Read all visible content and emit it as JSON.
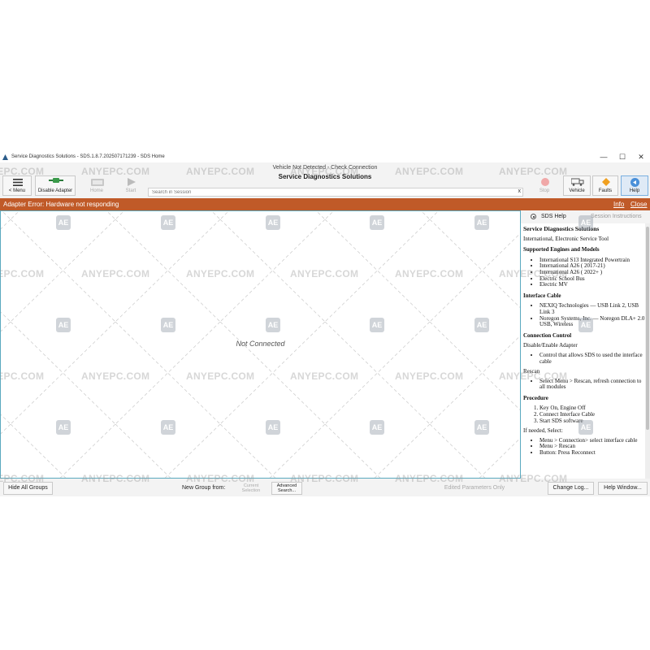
{
  "window": {
    "title": "Service Diagnostics Solutions - SDS.1.8.7.202507171239 - SDS Home",
    "minimize": "—",
    "maximize": "☐",
    "close": "✕"
  },
  "toolbar": {
    "menu_label": "< Menu",
    "disable_adapter_label": "Disable Adapter",
    "home_label": "Home",
    "start_label": "Start",
    "stop_label": "Stop",
    "vehicle_label": "Vehicle",
    "faults_label": "Faults",
    "help_label": "Help",
    "status_line1": "Vehicle Not Detected - Check Connection",
    "status_line2": "Service Diagnostics Solutions",
    "search_placeholder": "Search in Session",
    "search_clear": "x"
  },
  "error_bar": {
    "message": "Adapter Error: Hardware not responding",
    "info_link": "Info",
    "close_link": "Close"
  },
  "canvas": {
    "status_text": "Not Connected"
  },
  "help_pane": {
    "tab_help": "SDS Help",
    "tab_instructions": "Session Instructions",
    "title": "Service Diagnostics Solutions",
    "subtitle": "International, Electronic Service Tool",
    "sec_engines": "Supported Engines and Models",
    "engines": [
      "International S13 Integrated Powertrain",
      "International A26 ( 2017-21)",
      "International A26 ( 2022+ )",
      "Electric School Bus",
      "Electric MV"
    ],
    "sec_cable": "Interface Cable",
    "cables": [
      "NEXIQ Technologies — USB Link 2, USB Link 3",
      "Noregon Systems, Inc. — Noregon DLA+ 2.0 USB, Wireless"
    ],
    "sec_connection": "Connection Control",
    "connection_text": "Disable/Enable Adapter",
    "connection_items": [
      "Control that allows SDS to used the interface cable"
    ],
    "rescan_heading": "Rescan",
    "rescan_items": [
      "Select Menu > Rescan, refresh connection to all modules"
    ],
    "sec_procedure": "Procedure",
    "procedure": [
      "Key On, Engine Off",
      "Connect Interface Cable",
      "Start SDS software"
    ],
    "if_needed": "If needed, Select:",
    "if_needed_items": [
      "Menu > Connection> select interface cable",
      "Menu > Rescan",
      "Button: Press Reconnect"
    ]
  },
  "bottom_bar": {
    "hide_groups": "Hide All Groups",
    "new_group_from": "New Group from:",
    "current_selection": "Current Selection",
    "advanced_search": "Advanced Search...",
    "edited_only": "Edited Parameters Only",
    "change_log": "Change Log...",
    "help_window": "Help Window..."
  },
  "watermark": {
    "text": "ANYEPC.COM",
    "logo": "AE"
  },
  "colors": {
    "error_bar": "#c05a28",
    "canvas_border": "#5aa9bf",
    "help_active": "#4a90d9",
    "stop_icon": "#e05050",
    "faults_icon": "#f0a020"
  },
  "icons": {
    "menu": "hamburger-icon",
    "adapter": "adapter-plug-icon",
    "home": "home-icon",
    "start": "play-icon",
    "stop": "stop-icon",
    "vehicle": "truck-icon",
    "faults": "fault-warning-icon",
    "help": "help-icon"
  }
}
